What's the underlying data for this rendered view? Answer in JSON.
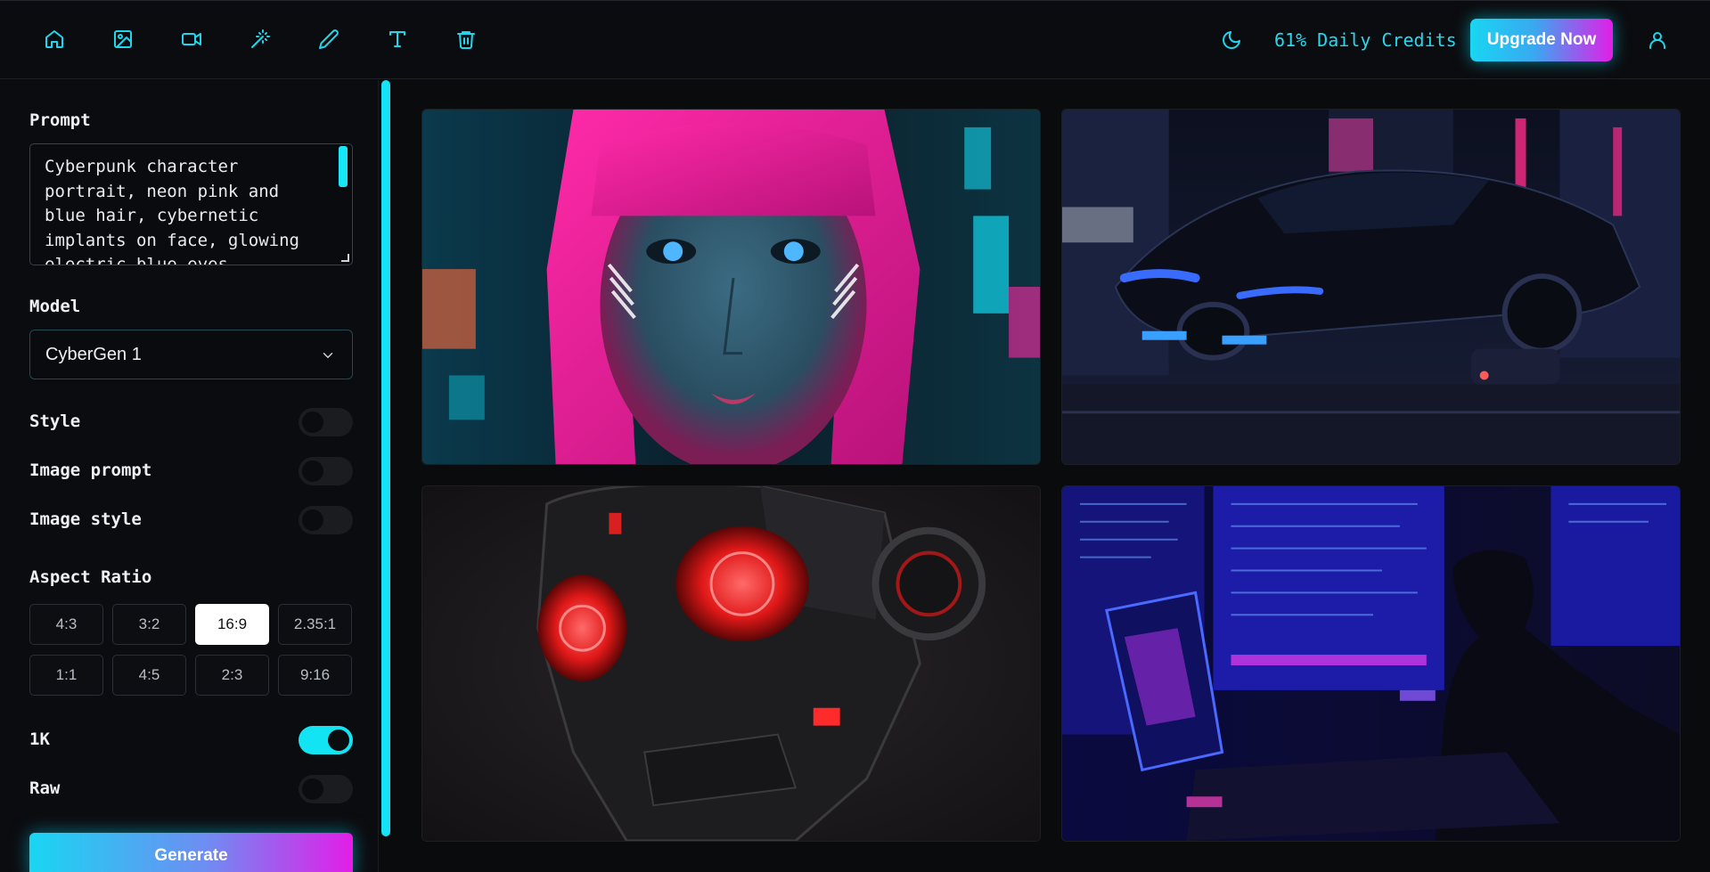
{
  "toolbar": {
    "tools": [
      "home-icon",
      "image-icon",
      "video-icon",
      "magic-wand-icon",
      "pencil-icon",
      "text-icon",
      "trash-icon"
    ],
    "theme_icon": "moon-icon",
    "credits_label": "61% Daily Credits",
    "upgrade_label": "Upgrade Now",
    "profile_icon": "user-icon"
  },
  "sidebar": {
    "prompt_label": "Prompt",
    "prompt_value": "Cyberpunk character portrait, neon pink and blue hair, cybernetic implants on face, glowing electric blue eyes",
    "model_label": "Model",
    "model_value": "CyberGen 1",
    "style_label": "Style",
    "style_on": false,
    "image_prompt_label": "Image prompt",
    "image_prompt_on": false,
    "image_style_label": "Image style",
    "image_style_on": false,
    "aspect_ratio_label": "Aspect Ratio",
    "ratios": [
      "4:3",
      "3:2",
      "16:9",
      "2.35:1",
      "1:1",
      "4:5",
      "2:3",
      "9:16"
    ],
    "selected_ratio": "16:9",
    "res_label": "1K",
    "res_on": true,
    "raw_label": "Raw",
    "raw_on": false,
    "generate_label": "Generate"
  },
  "gallery": {
    "images": [
      "cyberpunk-woman-portrait",
      "neon-sports-car",
      "red-eyed-robot",
      "hacker-at-monitors"
    ]
  },
  "colors": {
    "accent": "#1fd6ec",
    "pink": "#e21ee8",
    "background": "#0a0b0d"
  }
}
